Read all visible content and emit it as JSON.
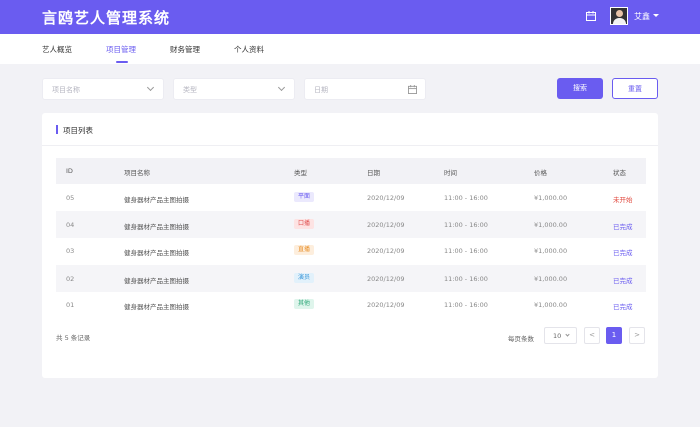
{
  "header": {
    "title": "言鸥艺人管理系统",
    "user_name": "艾鑫",
    "calendar_icon": "calendar-icon",
    "avatar_icon": "user-avatar"
  },
  "nav": {
    "items": [
      {
        "label": "艺人概览",
        "active": false
      },
      {
        "label": "项目管理",
        "active": true
      },
      {
        "label": "财务管理",
        "active": false
      },
      {
        "label": "个人资料",
        "active": false
      }
    ]
  },
  "filters": {
    "project_name_placeholder": "项目名称",
    "type_placeholder": "类型",
    "date_placeholder": "日期",
    "search_label": "搜索",
    "reset_label": "重置"
  },
  "card": {
    "title": "项目列表"
  },
  "table": {
    "headers": [
      "ID",
      "项目名称",
      "类型",
      "日期",
      "时间",
      "价格",
      "状态"
    ],
    "rows": [
      {
        "id": "05",
        "name": "健身器材产品主图拍摄",
        "type": "平面",
        "date": "2020/12/09",
        "time": "11:00 - 16:00",
        "price": "¥1,000.00",
        "status": "未开始"
      },
      {
        "id": "04",
        "name": "健身器材产品主图拍摄",
        "type": "口播",
        "date": "2020/12/09",
        "time": "11:00 - 16:00",
        "price": "¥1,000.00",
        "status": "已完成"
      },
      {
        "id": "03",
        "name": "健身器材产品主图拍摄",
        "type": "直播",
        "date": "2020/12/09",
        "time": "11:00 - 16:00",
        "price": "¥1,000.00",
        "status": "已完成"
      },
      {
        "id": "02",
        "name": "健身器材产品主图拍摄",
        "type": "演员",
        "date": "2020/12/09",
        "time": "11:00 - 16:00",
        "price": "¥1,000.00",
        "status": "已完成"
      },
      {
        "id": "01",
        "name": "健身器材产品主图拍摄",
        "type": "其他",
        "date": "2020/12/09",
        "time": "11:00 - 16:00",
        "price": "¥1,000.00",
        "status": "已完成"
      }
    ]
  },
  "pagination": {
    "total_text": "共 5 条记录",
    "per_page_label": "每页条数",
    "per_page_value": "10",
    "prev": "<",
    "current_page": "1",
    "next": ">"
  },
  "colors": {
    "accent": "#6a5cf0",
    "status_not_started": "#e0453a",
    "status_done": "#6a5cf0",
    "tag_flat": {
      "bg": "#ebe9fd",
      "fg": "#6a5cf0"
    },
    "tag_voice": {
      "bg": "#fde3e3",
      "fg": "#e05050"
    },
    "tag_live": {
      "bg": "#fdeedd",
      "fg": "#e8902a"
    },
    "tag_actor": {
      "bg": "#e2f1fb",
      "fg": "#3a96d8"
    },
    "tag_other": {
      "bg": "#dff5ec",
      "fg": "#2aa676"
    }
  }
}
